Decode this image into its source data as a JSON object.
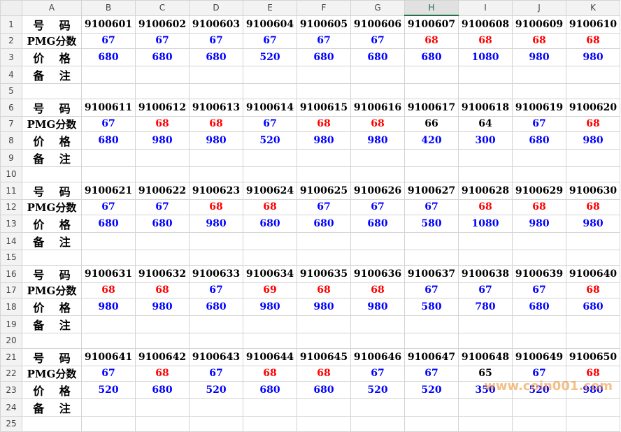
{
  "columns": [
    "A",
    "B",
    "C",
    "D",
    "E",
    "F",
    "G",
    "H",
    "I",
    "J",
    "K"
  ],
  "selected_column": "H",
  "labels": {
    "code": "号 码",
    "score": "PMG分数",
    "price": "价 格",
    "note": "备 注"
  },
  "colors": {
    "blue": "#0000ff",
    "red": "#ff0000",
    "black": "#000000"
  },
  "blocks": [
    {
      "codes": [
        "9100601",
        "9100602",
        "9100603",
        "9100604",
        "9100605",
        "9100606",
        "9100607",
        "9100608",
        "9100609",
        "9100610"
      ],
      "scores": [
        "67",
        "67",
        "67",
        "67",
        "67",
        "67",
        "68",
        "68",
        "68",
        "68"
      ],
      "score_colors": [
        "blue",
        "blue",
        "blue",
        "blue",
        "blue",
        "blue",
        "red",
        "red",
        "red",
        "red"
      ],
      "prices": [
        "680",
        "680",
        "680",
        "520",
        "680",
        "680",
        "680",
        "1080",
        "980",
        "980"
      ],
      "price_colors": [
        "blue",
        "blue",
        "blue",
        "blue",
        "blue",
        "blue",
        "blue",
        "blue",
        "blue",
        "blue"
      ]
    },
    {
      "codes": [
        "9100611",
        "9100612",
        "9100613",
        "9100614",
        "9100615",
        "9100616",
        "9100617",
        "9100618",
        "9100619",
        "9100620"
      ],
      "scores": [
        "67",
        "68",
        "68",
        "67",
        "68",
        "68",
        "66",
        "64",
        "67",
        "68"
      ],
      "score_colors": [
        "blue",
        "red",
        "red",
        "blue",
        "red",
        "red",
        "black",
        "black",
        "blue",
        "red"
      ],
      "prices": [
        "680",
        "980",
        "980",
        "520",
        "980",
        "980",
        "420",
        "300",
        "680",
        "980"
      ],
      "price_colors": [
        "blue",
        "blue",
        "blue",
        "blue",
        "blue",
        "blue",
        "blue",
        "blue",
        "blue",
        "blue"
      ]
    },
    {
      "codes": [
        "9100621",
        "9100622",
        "9100623",
        "9100624",
        "9100625",
        "9100626",
        "9100627",
        "9100628",
        "9100629",
        "9100630"
      ],
      "scores": [
        "67",
        "67",
        "68",
        "68",
        "67",
        "67",
        "67",
        "68",
        "68",
        "68"
      ],
      "score_colors": [
        "blue",
        "blue",
        "red",
        "red",
        "blue",
        "blue",
        "blue",
        "red",
        "red",
        "red"
      ],
      "prices": [
        "680",
        "680",
        "980",
        "680",
        "680",
        "680",
        "580",
        "1080",
        "980",
        "980"
      ],
      "price_colors": [
        "blue",
        "blue",
        "blue",
        "blue",
        "blue",
        "blue",
        "blue",
        "blue",
        "blue",
        "blue"
      ]
    },
    {
      "codes": [
        "9100631",
        "9100632",
        "9100633",
        "9100634",
        "9100635",
        "9100636",
        "9100637",
        "9100638",
        "9100639",
        "9100640"
      ],
      "scores": [
        "68",
        "68",
        "67",
        "69",
        "68",
        "68",
        "67",
        "67",
        "67",
        "68"
      ],
      "score_colors": [
        "red",
        "red",
        "blue",
        "red",
        "red",
        "red",
        "blue",
        "blue",
        "blue",
        "red"
      ],
      "prices": [
        "980",
        "980",
        "680",
        "980",
        "980",
        "980",
        "580",
        "780",
        "680",
        "680"
      ],
      "price_colors": [
        "blue",
        "blue",
        "blue",
        "blue",
        "blue",
        "blue",
        "blue",
        "blue",
        "blue",
        "blue"
      ]
    },
    {
      "codes": [
        "9100641",
        "9100642",
        "9100643",
        "9100644",
        "9100645",
        "9100646",
        "9100647",
        "9100648",
        "9100649",
        "9100650"
      ],
      "scores": [
        "67",
        "68",
        "67",
        "68",
        "68",
        "67",
        "67",
        "65",
        "67",
        "68"
      ],
      "score_colors": [
        "blue",
        "red",
        "blue",
        "red",
        "red",
        "blue",
        "blue",
        "black",
        "blue",
        "red"
      ],
      "prices": [
        "520",
        "680",
        "520",
        "680",
        "680",
        "520",
        "520",
        "350",
        "520",
        "980"
      ],
      "price_colors": [
        "blue",
        "blue",
        "blue",
        "blue",
        "blue",
        "blue",
        "blue",
        "blue",
        "blue",
        "blue"
      ]
    }
  ],
  "watermark": "www.coin001.com"
}
